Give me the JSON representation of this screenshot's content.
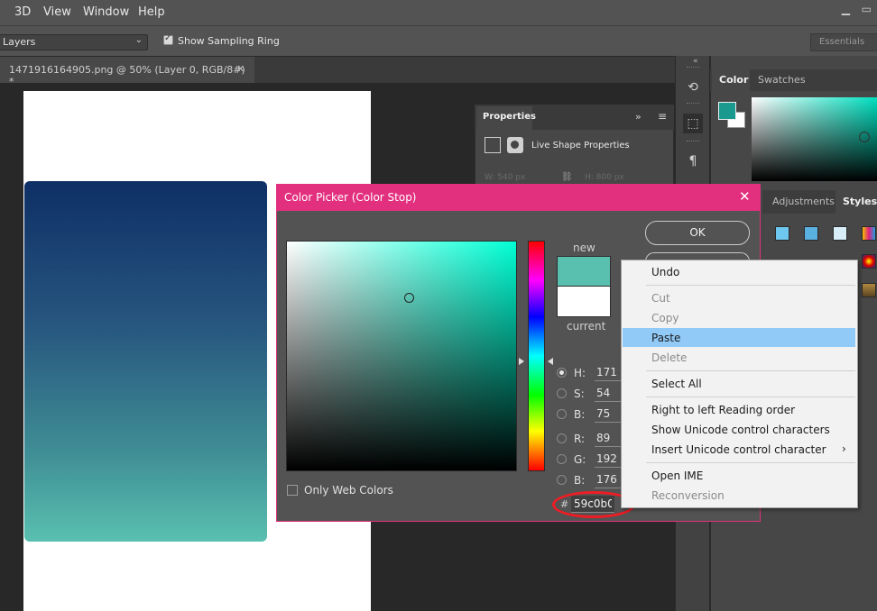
{
  "menubar": {
    "items": [
      "3D",
      "View",
      "Window",
      "Help"
    ]
  },
  "optionsbar": {
    "layers_select": "Layers",
    "sampling_ring_label": "Show Sampling Ring",
    "workspace": "Essentials"
  },
  "document": {
    "tab_title": "1471916164905.png @ 50% (Layer 0, RGB/8#) *",
    "gradient_colors": [
      "#0e2f66",
      "#59c0b0"
    ]
  },
  "right_panel": {
    "color_tab": "Color",
    "swatches_tab": "Swatches",
    "adjustments_tab": "Adjustments",
    "styles_tab": "Styles",
    "foreground_color": "#1a9a8e"
  },
  "properties": {
    "tab": "Properties",
    "title": "Live Shape Properties",
    "w_label": "W:  540 px",
    "h_label": "H:  800 px"
  },
  "color_picker": {
    "title": "Color Picker (Color Stop)",
    "ok_label": "OK",
    "new_label": "new",
    "current_label": "current",
    "new_color": "#59c0b0",
    "current_color": "#ffffff",
    "fields": {
      "h": {
        "label": "H:",
        "value": "171",
        "selected": true
      },
      "s": {
        "label": "S:",
        "value": "54"
      },
      "b": {
        "label": "B:",
        "value": "75"
      },
      "r": {
        "label": "R:",
        "value": "89"
      },
      "g": {
        "label": "G:",
        "value": "192"
      },
      "b2": {
        "label": "B:",
        "value": "176"
      }
    },
    "hash": "#",
    "hex_value": "59c0b0",
    "only_web_colors": "Only Web Colors"
  },
  "context_menu": {
    "items": {
      "undo": "Undo",
      "cut": "Cut",
      "copy": "Copy",
      "paste": "Paste",
      "delete": "Delete",
      "select_all": "Select All",
      "rtl": "Right to left Reading order",
      "show_unicode": "Show Unicode control characters",
      "insert_unicode": "Insert Unicode control character",
      "open_ime": "Open IME",
      "reconversion": "Reconversion"
    },
    "highlighted": "Paste"
  }
}
